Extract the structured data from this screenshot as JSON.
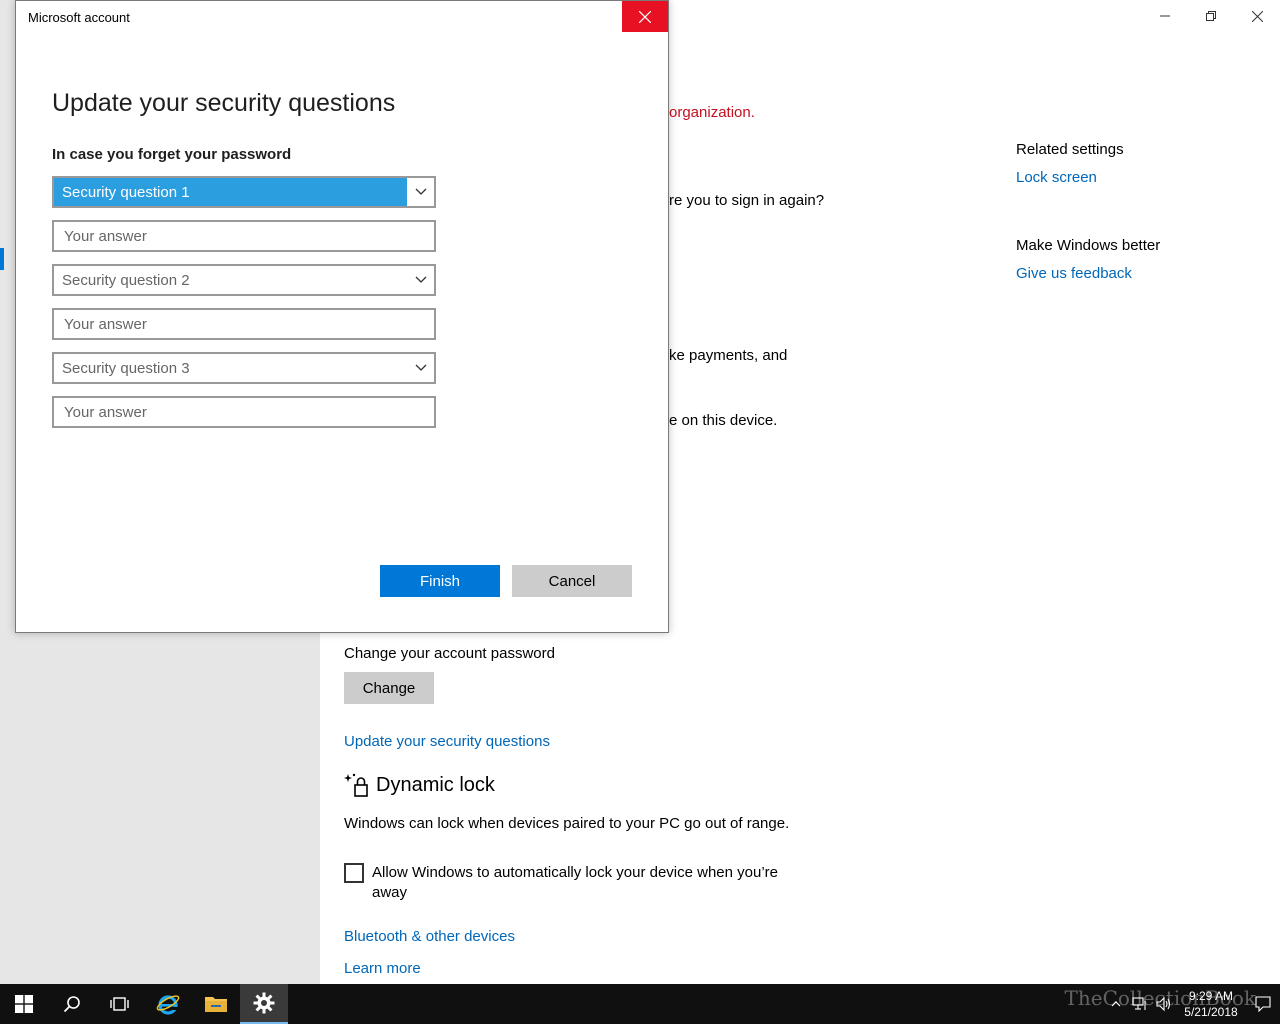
{
  "settings": {
    "partial_org_text": "organization.",
    "partial_signin_text": "re you to sign in again?",
    "partial_payments_text": "ke payments, and",
    "partial_device_text": "e on this device.",
    "related_settings": {
      "title": "Related settings",
      "lock_screen_link": "Lock screen"
    },
    "make_windows_better": {
      "title": "Make Windows better",
      "feedback_link": "Give us feedback"
    },
    "password": {
      "label": "Change your account password",
      "change_button": "Change",
      "update_questions_link": "Update your security questions"
    },
    "dynamic_lock": {
      "title": "Dynamic lock",
      "description": "Windows can lock when devices paired to your PC go out of range.",
      "checkbox_label": "Allow Windows to automatically lock your device when you’re away",
      "checkbox_checked": false,
      "bluetooth_link": "Bluetooth & other devices",
      "learn_more_link": "Learn more"
    }
  },
  "dialog": {
    "window_title": "Microsoft account",
    "heading": "Update your security questions",
    "subheading": "In case you forget your password",
    "questions": [
      {
        "select_label": "Security question 1",
        "answer_placeholder": "Your answer",
        "answer_value": ""
      },
      {
        "select_label": "Security question 2",
        "answer_placeholder": "Your answer",
        "answer_value": ""
      },
      {
        "select_label": "Security question 3",
        "answer_placeholder": "Your answer",
        "answer_value": ""
      }
    ],
    "finish_button": "Finish",
    "cancel_button": "Cancel"
  },
  "taskbar": {
    "time": "9:29 AM",
    "date": "5/21/2018",
    "watermark": "TheCollectionBook",
    "icons": [
      "windows-start-icon",
      "search-icon",
      "task-view-icon",
      "internet-explorer-icon",
      "file-explorer-icon",
      "settings-gear-icon"
    ]
  },
  "colors": {
    "accent": "#0078d7",
    "link": "#0067b8",
    "error": "#c50f1f",
    "close_red": "#e81123",
    "select_highlight": "#2b9ee0"
  }
}
